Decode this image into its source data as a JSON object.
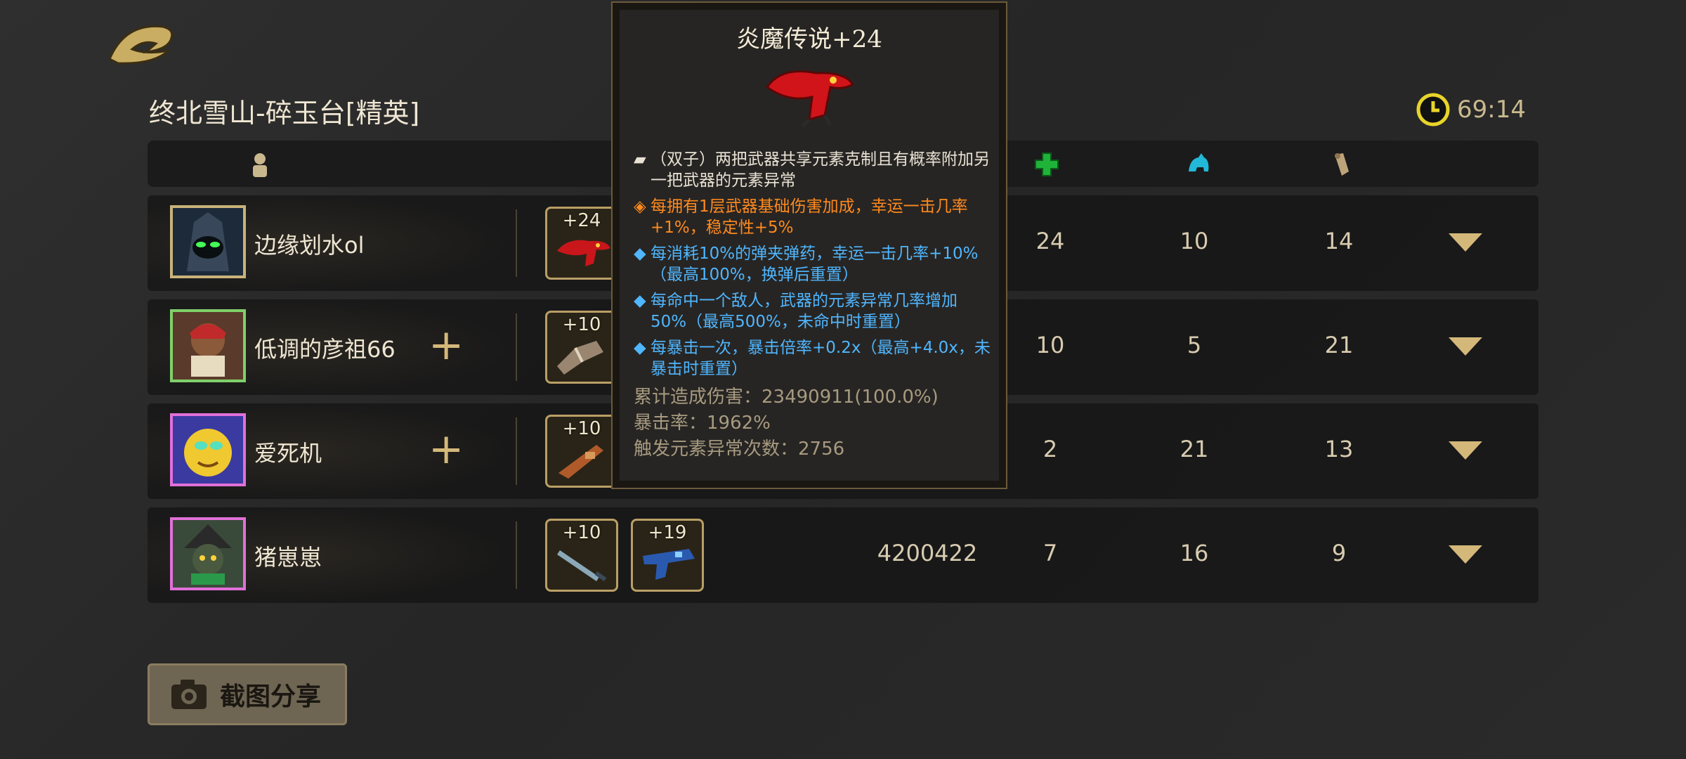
{
  "stage_title": "终北雪山-碎玉台[精英]",
  "timer": "69:14",
  "header_icons": [
    "person-icon",
    "heal-cross-icon",
    "pet-icon",
    "scroll-icon"
  ],
  "players": [
    {
      "name": "边缘划水ol",
      "weapons": [
        {
          "level": "+24",
          "icon": "fire-demon-gun-icon"
        }
      ],
      "damage": "",
      "heal": "24",
      "pet": "10",
      "misc": "14",
      "has_plus": false,
      "frame": "gold"
    },
    {
      "name": "低调的彦祖66",
      "weapons": [
        {
          "level": "+10",
          "icon": "crossbow-icon"
        }
      ],
      "damage": "",
      "heal": "10",
      "pet": "5",
      "misc": "21",
      "has_plus": true,
      "frame": "green"
    },
    {
      "name": "爱死机",
      "weapons": [
        {
          "level": "+10",
          "icon": "shotgun-icon"
        }
      ],
      "damage": "",
      "heal": "2",
      "pet": "21",
      "misc": "13",
      "has_plus": true,
      "frame": "pink"
    },
    {
      "name": "猪崽崽",
      "weapons": [
        {
          "level": "+10",
          "icon": "sword-icon"
        },
        {
          "level": "+19",
          "icon": "blue-gun-icon"
        }
      ],
      "damage": "4200422",
      "heal": "7",
      "pet": "16",
      "misc": "9",
      "has_plus": false,
      "frame": "pink2"
    }
  ],
  "share_button": "截图分享",
  "tooltip": {
    "title": "炎魔传说+24",
    "lines": [
      {
        "bullet": "▰",
        "color": "white",
        "text": "（双子）两把武器共享元素克制且有概率附加另一把武器的元素异常"
      },
      {
        "bullet": "◈",
        "color": "orange",
        "text": "每拥有1层武器基础伤害加成，幸运一击几率+1%，稳定性+5%"
      },
      {
        "bullet": "◆",
        "color": "blue",
        "text": "每消耗10%的弹夹弹药，幸运一击几率+10%（最高100%，换弹后重置）"
      },
      {
        "bullet": "◆",
        "color": "blue",
        "text": "每命中一个敌人，武器的元素异常几率增加50%（最高500%，未命中时重置）"
      },
      {
        "bullet": "◆",
        "color": "blue",
        "text": "每暴击一次，暴击倍率+0.2x（最高+4.0x，未暴击时重置）"
      }
    ],
    "stats": [
      "累计造成伤害：23490911(100.0%)",
      "暴击率：1962%",
      "触发元素异常次数：2756"
    ]
  }
}
